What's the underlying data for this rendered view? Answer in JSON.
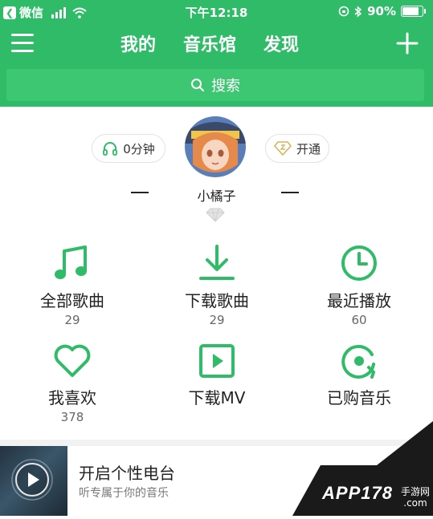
{
  "status_bar": {
    "carrier": "微信",
    "time": "下午12:18",
    "battery": "90%"
  },
  "header": {
    "tabs": [
      "我的",
      "音乐馆",
      "发现"
    ],
    "search_placeholder": "搜索"
  },
  "profile": {
    "listen_time": "0分钟",
    "vip_label": "开通",
    "username": "小橘子"
  },
  "grid": [
    {
      "label": "全部歌曲",
      "count": "29",
      "icon": "music-note-icon"
    },
    {
      "label": "下载歌曲",
      "count": "29",
      "icon": "download-icon"
    },
    {
      "label": "最近播放",
      "count": "60",
      "icon": "clock-icon"
    },
    {
      "label": "我喜欢",
      "count": "378",
      "icon": "heart-icon"
    },
    {
      "label": "下载MV",
      "count": "",
      "icon": "video-play-icon"
    },
    {
      "label": "已购音乐",
      "count": "",
      "icon": "purchased-music-icon"
    }
  ],
  "radio": {
    "title": "开启个性电台",
    "subtitle": "听专属于你的音乐"
  },
  "watermark": {
    "brand": "APP178",
    "site_line1": "手游网",
    "site_line2": ".com"
  },
  "colors": {
    "accent": "#2fbb68",
    "search_bg": "#3ec772",
    "text": "#222222"
  }
}
